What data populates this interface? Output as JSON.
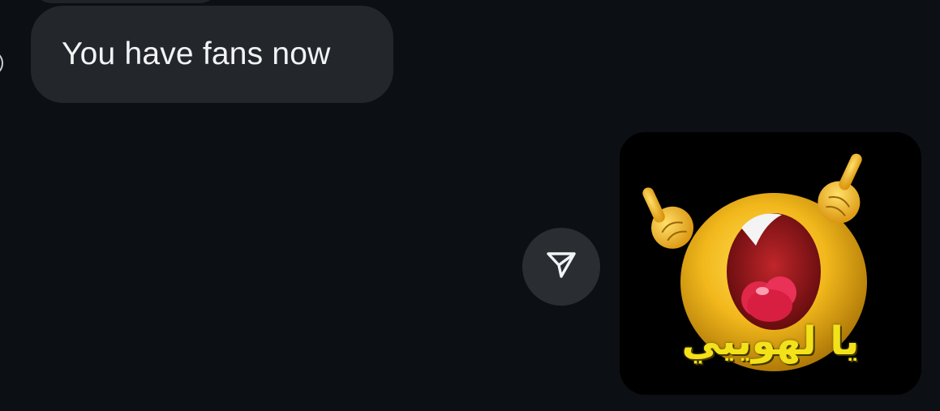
{
  "conversation": {
    "received_message": {
      "text": "You have fans now"
    },
    "sent_sticker": {
      "caption": "يا لهوييي",
      "description_icon": "crying-smiley-sticker"
    },
    "share_button": {
      "icon": "send-icon"
    }
  },
  "colors": {
    "background": "#0c0f13",
    "bubble": "#23272c",
    "bubble_text": "#f2f3f5",
    "share_button_bg": "#2a2e33",
    "sticker_text": "#f3e21a"
  }
}
